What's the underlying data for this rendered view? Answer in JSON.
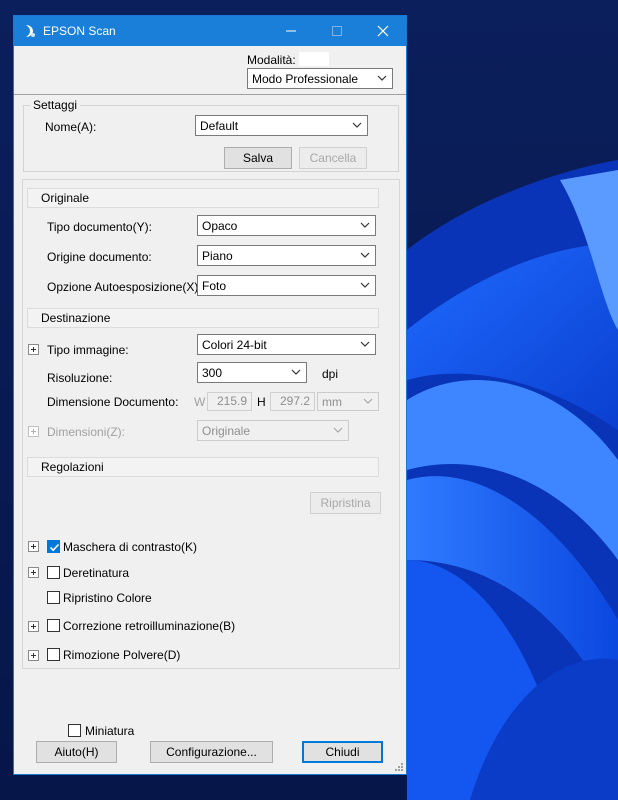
{
  "window": {
    "title": "EPSON Scan",
    "accent": "#1a7fd9"
  },
  "mode": {
    "label": "Modalità:",
    "selected": "Modo Professionale"
  },
  "settings": {
    "group_title": "Settaggi",
    "name_label": "Nome(A):",
    "name_value": "Default",
    "save": "Salva",
    "delete": "Cancella"
  },
  "original": {
    "header": "Originale",
    "doc_type_label": "Tipo documento(Y):",
    "doc_type_value": "Opaco",
    "doc_source_label": "Origine documento:",
    "doc_source_value": "Piano",
    "auto_exposure_label": "Opzione Autoesposizione(X):",
    "auto_exposure_value": "Foto"
  },
  "destination": {
    "header": "Destinazione",
    "image_type_label": "Tipo immagine:",
    "image_type_value": "Colori 24-bit",
    "resolution_label": "Risoluzione:",
    "resolution_value": "300",
    "resolution_unit": "dpi",
    "doc_size_label": "Dimensione Documento:",
    "w_label": "W",
    "w_value": "215.9",
    "h_label": "H",
    "h_value": "297.2",
    "unit_value": "mm",
    "target_size_label": "Dimensioni(Z):",
    "target_size_value": "Originale"
  },
  "adjustments": {
    "header": "Regolazioni",
    "reset": "Ripristina",
    "unsharp_mask": {
      "label": "Maschera di contrasto(K)",
      "checked": true
    },
    "descreening": {
      "label": "Deretinatura",
      "checked": false
    },
    "color_restoration": {
      "label": "Ripristino Colore",
      "checked": false
    },
    "backlight_correction": {
      "label": "Correzione retroilluminazione(B)",
      "checked": false
    },
    "dust_removal": {
      "label": "Rimozione Polvere(D)",
      "checked": false
    }
  },
  "footer": {
    "thumbnail": {
      "label": "Miniatura",
      "checked": false
    },
    "help": "Aiuto(H)",
    "configuration": "Configurazione...",
    "close": "Chiudi"
  }
}
